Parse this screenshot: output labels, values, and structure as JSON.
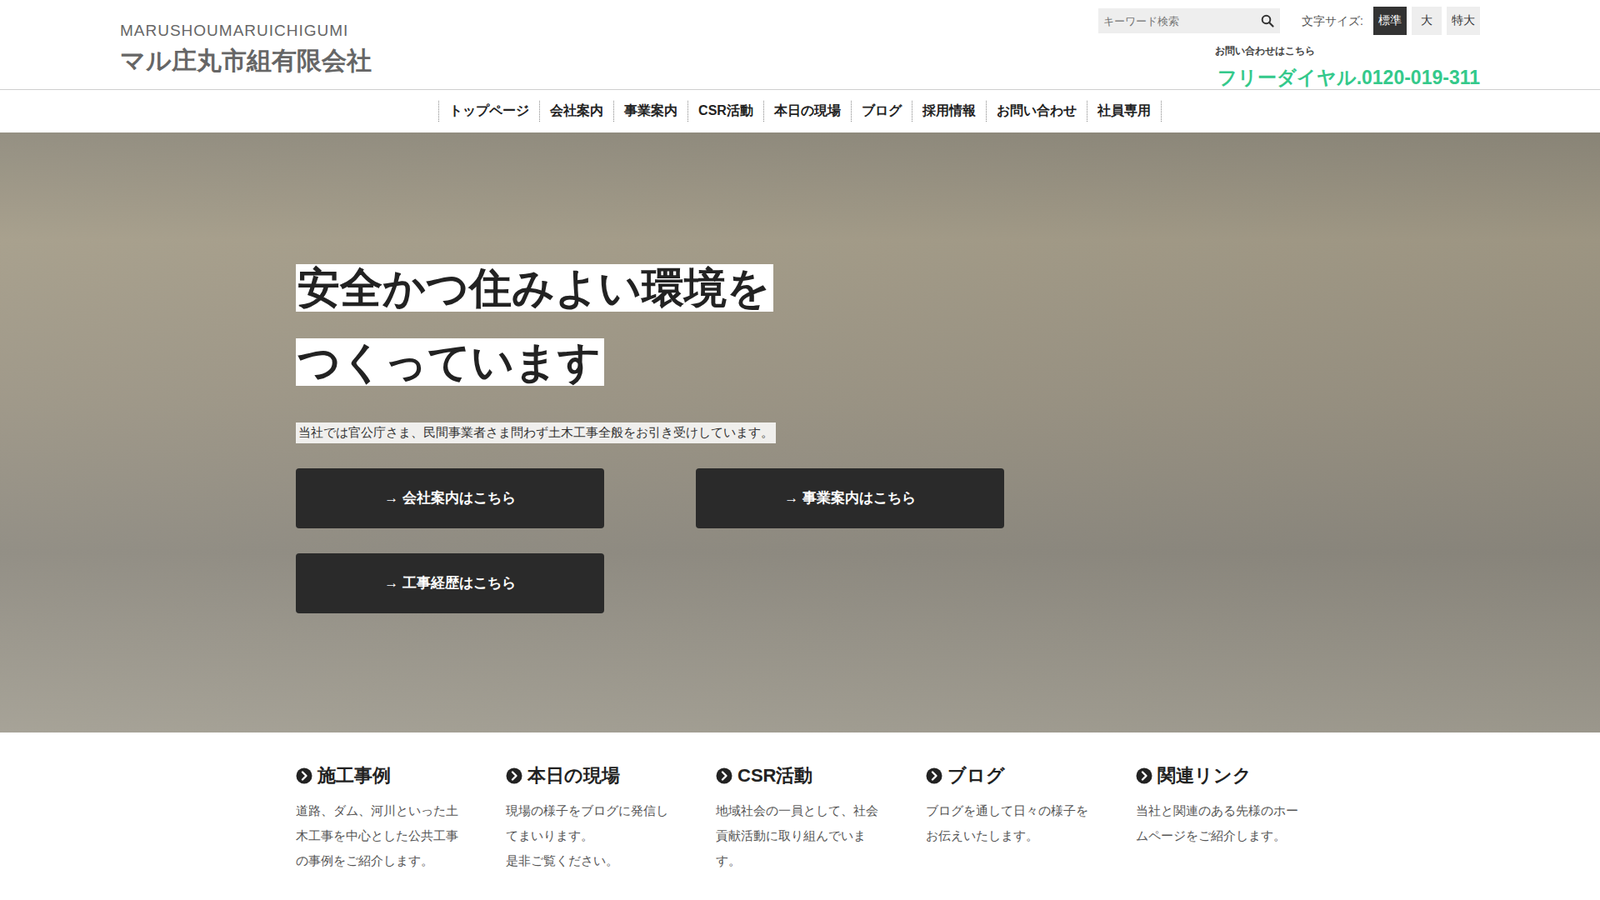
{
  "header": {
    "romaji": "MARUSHOUMARUICHIGUMI",
    "company": "マル庄丸市組有限会社",
    "search": {
      "placeholder": "キーワード検索"
    },
    "font_size": {
      "label": "文字サイズ:",
      "options": [
        {
          "label": "標準",
          "selected": true
        },
        {
          "label": "大",
          "selected": false
        },
        {
          "label": "特大",
          "selected": false
        }
      ]
    },
    "contact_label": "お問い合わせはこちら",
    "phone": "フリーダイヤル.0120-019-311"
  },
  "nav": [
    "トップページ",
    "会社案内",
    "事業案内",
    "CSR活動",
    "本日の現場",
    "ブログ",
    "採用情報",
    "お問い合わせ",
    "社員専用"
  ],
  "hero": {
    "headline": [
      "安全かつ住みよい環境を",
      "つくっています"
    ],
    "lead": "当社では官公庁さま、民間事業者さま問わず土木工事全般をお引き受けしています。",
    "buttons": [
      "→ 会社案内はこちら",
      "→ 事業案内はこちら",
      "→ 工事経歴はこちら"
    ]
  },
  "features": [
    {
      "title": "施工事例",
      "text": "道路、ダム、河川といった土木工事を中心とした公共工事の事例をご紹介します。"
    },
    {
      "title": "本日の現場",
      "text": "現場の様子をブログに発信してまいります。\n是非ご覧ください。"
    },
    {
      "title": "CSR活動",
      "text": "地域社会の一員として、社会貢献活動に取り組んでいます。"
    },
    {
      "title": "ブログ",
      "text": "ブログを通して日々の様子をお伝えいたします。"
    },
    {
      "title": "関連リンク",
      "text": "当社と関連のある先様のホームページをご紹介します。"
    }
  ]
}
